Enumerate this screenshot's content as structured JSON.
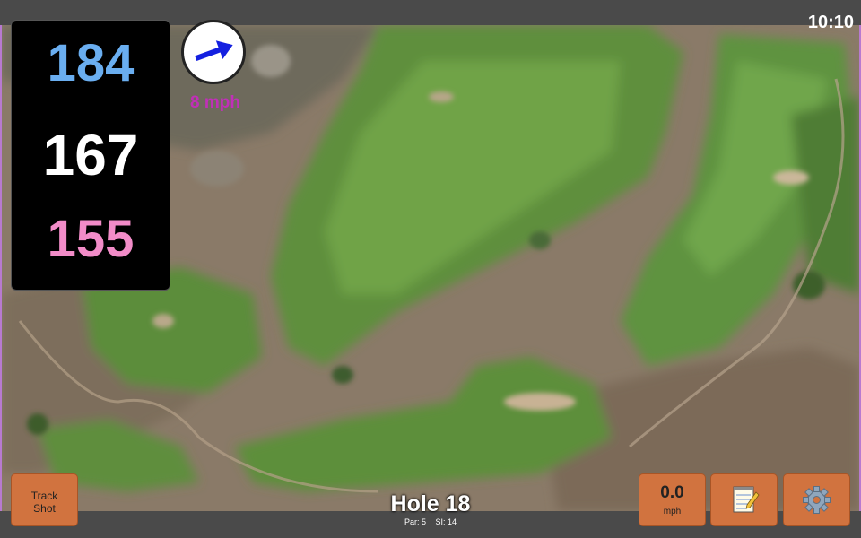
{
  "status": {
    "clock": "10:10"
  },
  "distances": {
    "back": "184",
    "middle": "167",
    "front": "155",
    "colors": {
      "back": "#6aaef0",
      "middle": "#ffffff",
      "front": "#f28cc8"
    }
  },
  "wind": {
    "speed_label": "8 mph",
    "arrow_icon": "wind-arrow-icon",
    "arrow_color": "#1420e0"
  },
  "buttons": {
    "track_line1": "Track",
    "track_line2": "Shot",
    "speed_value": "0.0",
    "speed_unit": "mph",
    "notes_icon": "notepad-icon",
    "settings_icon": "gear-icon",
    "button_color": "#d1733f"
  },
  "hole": {
    "title": "Hole 18",
    "par_label": "Par: 5",
    "si_label": "SI: 14"
  }
}
